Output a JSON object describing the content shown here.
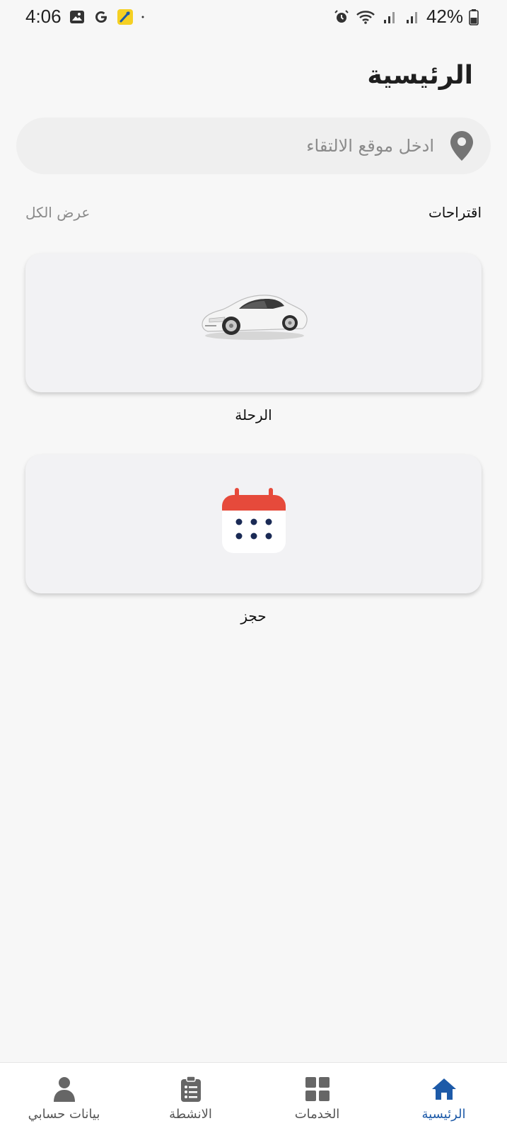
{
  "status_bar": {
    "time": "4:06",
    "battery": "42%",
    "left_icons": [
      "gallery-icon",
      "google-icon",
      "app-notification-icon",
      "dot-icon"
    ],
    "right_icons": [
      "alarm-icon",
      "wifi-icon",
      "signal-icon",
      "signal-icon",
      "battery-icon"
    ]
  },
  "header": {
    "title": "الرئيسية"
  },
  "search": {
    "placeholder": "ادخل موقع الالتقاء",
    "value": "",
    "icon": "location-pin-icon"
  },
  "suggestions": {
    "title": "اقتراحات",
    "view_all": "عرض الكل",
    "items": [
      {
        "label": "الرحلة",
        "icon": "car-icon"
      },
      {
        "label": "حجز",
        "icon": "calendar-icon"
      }
    ]
  },
  "bottom_nav": {
    "items": [
      {
        "label": "الرئيسية",
        "icon": "home-icon",
        "active": true
      },
      {
        "label": "الخدمات",
        "icon": "grid-icon",
        "active": false
      },
      {
        "label": "الانشطة",
        "icon": "clipboard-list-icon",
        "active": false
      },
      {
        "label": "بيانات حسابي",
        "icon": "user-icon",
        "active": false
      }
    ]
  },
  "colors": {
    "accent": "#1d5aa8",
    "calendar_red": "#e64a3b",
    "calendar_dots": "#1a2a55",
    "background": "#f7f7f7"
  }
}
